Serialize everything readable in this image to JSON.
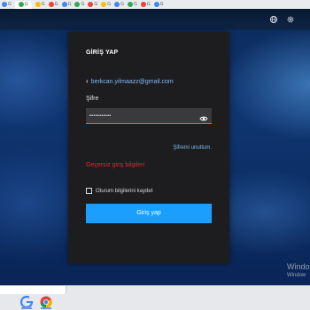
{
  "browser": {
    "bookmarks": [
      {
        "label": "G",
        "color": "#4285f4"
      },
      {
        "label": "G",
        "color": "#34a853"
      },
      {
        "label": "G",
        "color": "#fbbc05"
      },
      {
        "label": "G",
        "color": "#ea4335"
      },
      {
        "label": "G",
        "color": "#4285f4"
      },
      {
        "label": "G",
        "color": "#34a853"
      },
      {
        "label": "G",
        "color": "#ea4335"
      },
      {
        "label": "G",
        "color": "#fbbc05"
      },
      {
        "label": "G",
        "color": "#4285f4"
      },
      {
        "label": "G",
        "color": "#34a853"
      },
      {
        "label": "G",
        "color": "#ea4335"
      },
      {
        "label": "G",
        "color": "#4285f4"
      }
    ]
  },
  "appbar": {
    "globe_icon": "globe-icon",
    "settings_icon": "gear-icon"
  },
  "login": {
    "title": "GİRİŞ YAP",
    "email": "berkcan.yilmaazz@gmail.com",
    "password_label": "Şifre",
    "password_masked": "•••••••••••",
    "forgot_label": "Şifremi unuttum.",
    "error_text": "Geçersiz giriş bilgileri",
    "remember_label": "Oturum bilgilerini kaydet",
    "submit_label": "Giriş yap",
    "accent_color": "#1a9fff",
    "error_color": "#e0262e"
  },
  "watermark": {
    "title": "Windo",
    "subtitle": "Window"
  }
}
